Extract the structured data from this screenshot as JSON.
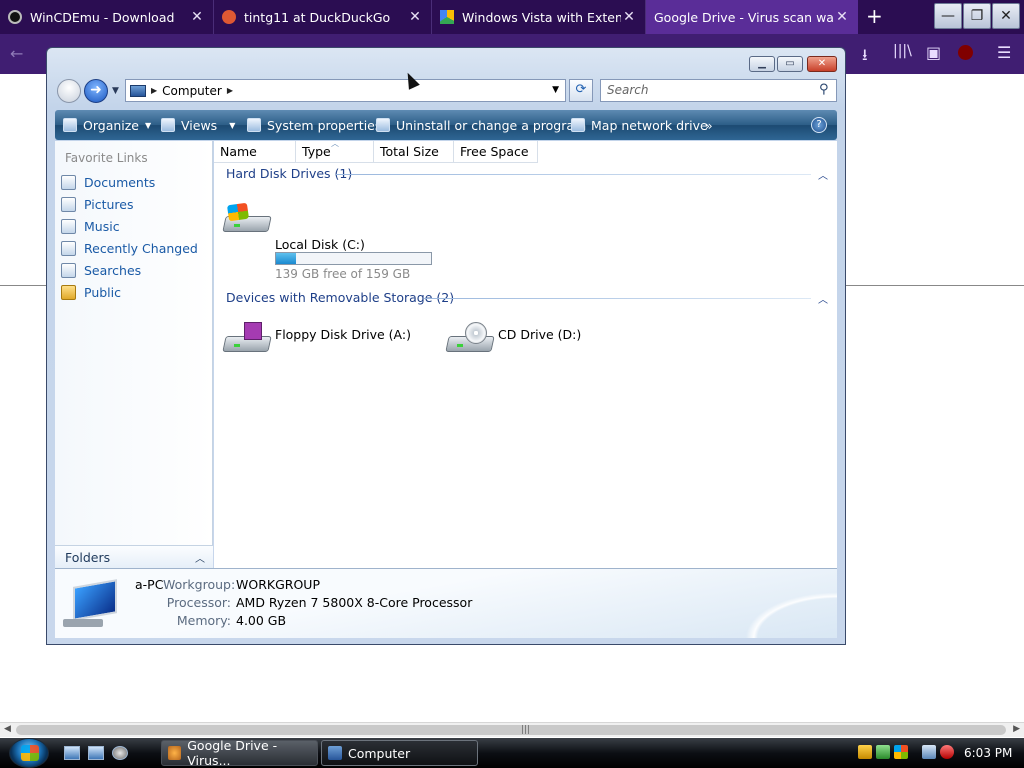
{
  "browser": {
    "tabs": [
      {
        "title": "WinCDEmu - Download",
        "active": false
      },
      {
        "title": "tintg11 at DuckDuckGo",
        "active": false
      },
      {
        "title": "Windows Vista with Extended",
        "active": false
      },
      {
        "title": "Google Drive - Virus scan warning",
        "active": true
      }
    ],
    "new_tab_symbol": "+",
    "tab_close_symbol": "✕",
    "window_buttons": {
      "minimize": "—",
      "restore": "❐",
      "close": "✕"
    },
    "toolbar_icons": [
      "back-icon",
      "download-icon",
      "library-icon",
      "sidebar-icon",
      "ublock-icon",
      "menu-icon"
    ]
  },
  "explorer": {
    "caption_buttons": {
      "minimize": "▁",
      "maximize": "▭",
      "close": "✕"
    },
    "address": {
      "location": "Computer"
    },
    "search": {
      "placeholder": "Search"
    },
    "commands": {
      "organize": "Organize",
      "views": "Views",
      "system_properties": "System properties",
      "uninstall": "Uninstall or change a program",
      "map_drive": "Map network drive",
      "more": "»"
    },
    "nav": {
      "favorite_links_title": "Favorite Links",
      "links": [
        "Documents",
        "Pictures",
        "Music",
        "Recently Changed",
        "Searches",
        "Public"
      ],
      "folders_label": "Folders"
    },
    "columns": [
      "Name",
      "Type",
      "Total Size",
      "Free Space"
    ],
    "groups": {
      "hard_disks": {
        "title": "Hard Disk Drives (1)"
      },
      "removable": {
        "title": "Devices with Removable Storage (2)"
      }
    },
    "drives": {
      "local": {
        "name": "Local Disk (C:)",
        "free_text": "139 GB free of 159 GB",
        "used_fraction": 0.126
      },
      "floppy": {
        "name": "Floppy Disk Drive (A:)"
      },
      "cd": {
        "name": "CD Drive (D:)"
      }
    },
    "details": {
      "computer_name": "a-PC",
      "workgroup_label": "Workgroup:",
      "workgroup": "WORKGROUP",
      "processor_label": "Processor:",
      "processor": "AMD Ryzen 7 5800X 8-Core Processor",
      "memory_label": "Memory:",
      "memory": "4.00 GB"
    }
  },
  "taskbar": {
    "buttons": [
      {
        "label": "Google Drive - Virus...",
        "active": false
      },
      {
        "label": "Computer",
        "active": true
      }
    ],
    "clock": "6:03 PM"
  },
  "colors": {
    "firefox_tabstrip": "#2b0d52",
    "firefox_active_tab": "#5a2d98",
    "vista_link": "#1a5aa6",
    "vista_group": "#1e3f88"
  }
}
